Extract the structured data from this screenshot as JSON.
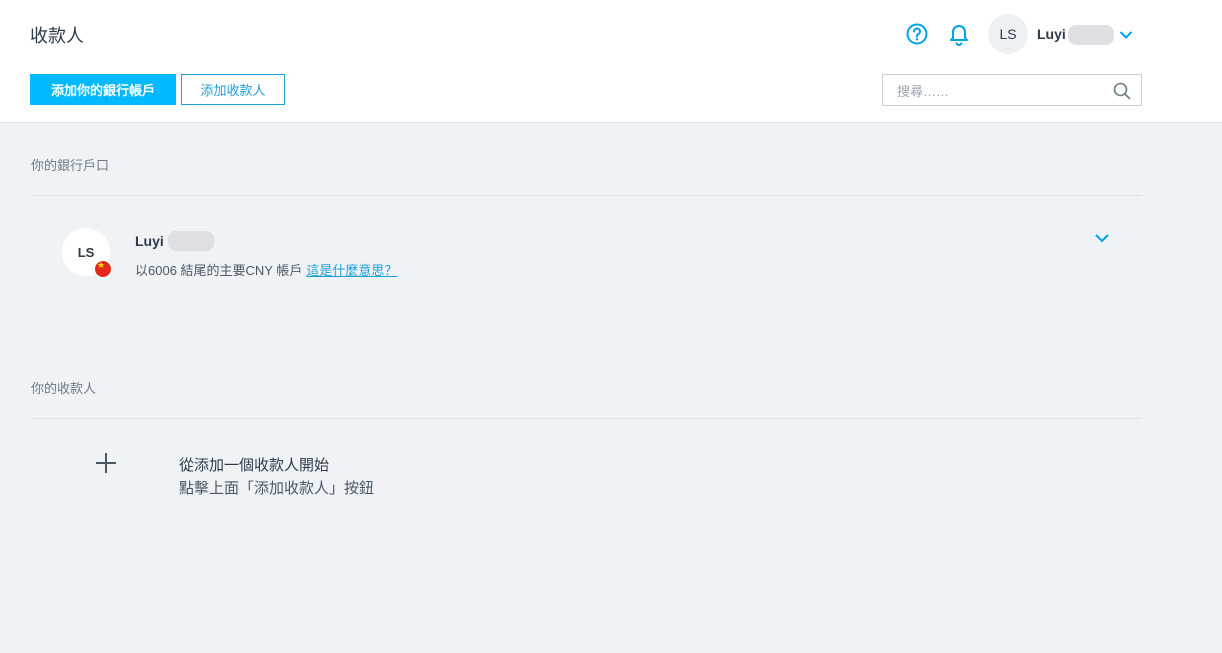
{
  "header": {
    "title": "收款人",
    "add_bank_label": "添加你的銀行帳戶",
    "add_recipient_label": "添加收款人",
    "search_placeholder": "搜尋……",
    "user": {
      "initials": "LS",
      "name": "Luyi"
    },
    "icons": [
      "help-icon",
      "bell-icon",
      "chevron-down-icon",
      "search-icon"
    ],
    "accent_color": "#00b9ff"
  },
  "bank_section": {
    "label": "你的銀行戶口",
    "account": {
      "initials": "LS",
      "name": "Luyi",
      "description": "以6006 結尾的主要CNY 帳戶",
      "link_text": "這是什麼意思？"
    }
  },
  "recipients_section": {
    "label": "你的收款人",
    "empty_title": "從添加一個收款人開始",
    "empty_subtitle": "點擊上面「添加收款人」按鈕"
  }
}
